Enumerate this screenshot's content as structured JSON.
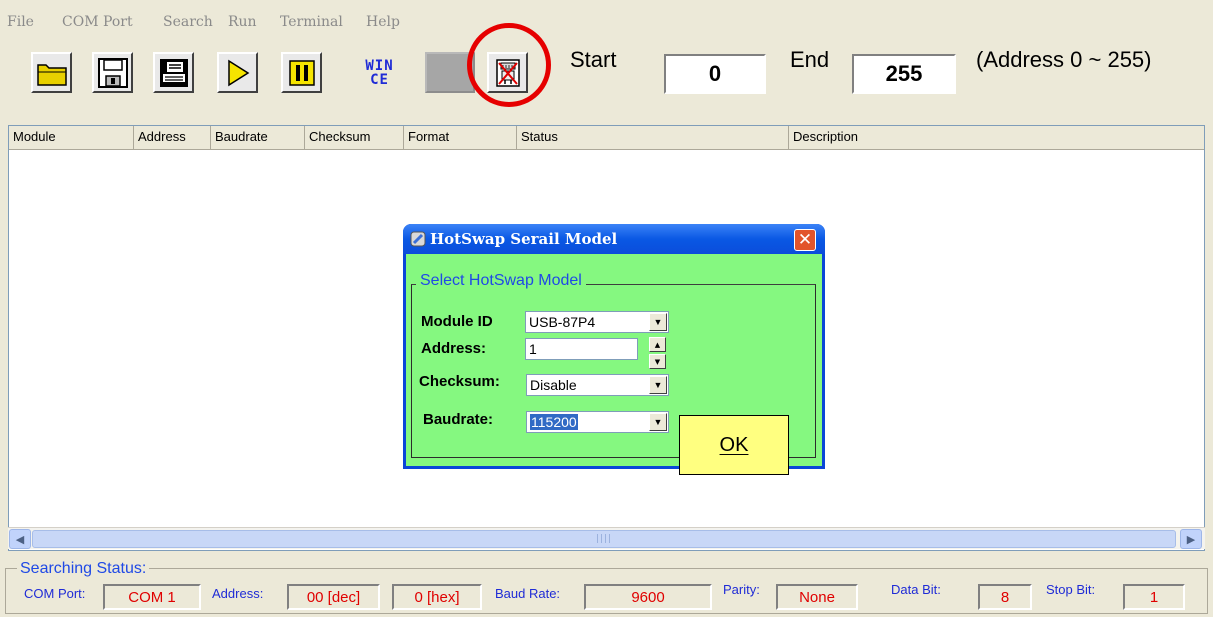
{
  "menu": [
    "File",
    "COM Port",
    "Search",
    "Run",
    "Terminal",
    "Help"
  ],
  "toolbar": {
    "wince_line1": "WIN",
    "wince_line2": "CE",
    "start_label": "Start",
    "start_value": "0",
    "end_label": "End",
    "end_value": "255",
    "range_note": "(Address 0 ~ 255)"
  },
  "list": {
    "columns": [
      "Module",
      "Address",
      "Baudrate",
      "Checksum",
      "Format",
      "Status",
      "Description"
    ],
    "scroll_grip": "||||"
  },
  "dialog": {
    "title": "HotSwap Serail Model",
    "close": "✕",
    "group_title": "Select HotSwap Model",
    "module_id_label": "Module ID",
    "module_id_value": "USB-87P4",
    "address_label": "Address:",
    "address_value": "1",
    "checksum_label": "Checksum:",
    "checksum_value": "Disable",
    "baudrate_label": "Baudrate:",
    "baudrate_value": "115200",
    "ok_label": "OK"
  },
  "status": {
    "title": "Searching Status:",
    "com_port_label": "COM Port:",
    "com_port_value": "COM 1",
    "address_label": "Address:",
    "address_dec": "00 [dec]",
    "address_hex": "0 [hex]",
    "baud_label": "Baud Rate:",
    "baud_value": "9600",
    "parity_label": "Parity:",
    "parity_value": "None",
    "databit_label": "Data Bit:",
    "databit_value": "8",
    "stopbit_label": "Stop Bit:",
    "stopbit_value": "1"
  },
  "colors": {
    "highlight": "#e60000",
    "dialog_bg": "#85f880",
    "ok_bg": "#ffff80",
    "status_value": "#e00000"
  }
}
